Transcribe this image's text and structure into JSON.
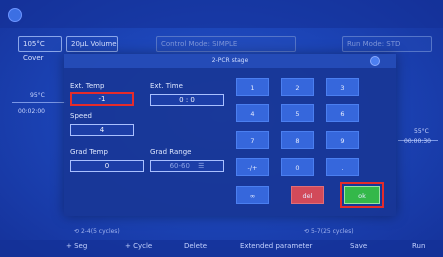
{
  "header": {
    "cover_temp": "105°C Cover",
    "volume": "20µL Volume",
    "control_mode": "Control Mode: SIMPLE",
    "run_mode": "Run Mode: STD"
  },
  "protocol": {
    "left_temp": "95°C",
    "left_time": "00:02:00",
    "right_temp": "55°C",
    "right_time": "00:00:30",
    "left_cycles": "2-4(5 cycles)",
    "right_cycles": "5-7(25 cycles)"
  },
  "dialog": {
    "title": "2-PCR stage",
    "ext_temp": {
      "label": "Ext. Temp",
      "value": "-1"
    },
    "ext_time": {
      "label": "Ext. Time",
      "value": "0 : 0"
    },
    "speed": {
      "label": "Speed",
      "value": "4"
    },
    "grad_temp": {
      "label": "Grad Temp",
      "value": "0"
    },
    "grad_range": {
      "label": "Grad Range",
      "value": "60-60"
    }
  },
  "keypad": {
    "k1": "1",
    "k2": "2",
    "k3": "3",
    "k4": "4",
    "k5": "5",
    "k6": "6",
    "k7": "7",
    "k8": "8",
    "k9": "9",
    "sign": "-/+",
    "k0": "0",
    "dot": ".",
    "inf": "∞",
    "del": "del",
    "ok": "ok"
  },
  "toolbar": {
    "add_seg": "+ Seg",
    "add_cycle": "+ Cycle",
    "delete": "Delete",
    "extended": "Extended parameter",
    "save": "Save",
    "run": "Run"
  }
}
